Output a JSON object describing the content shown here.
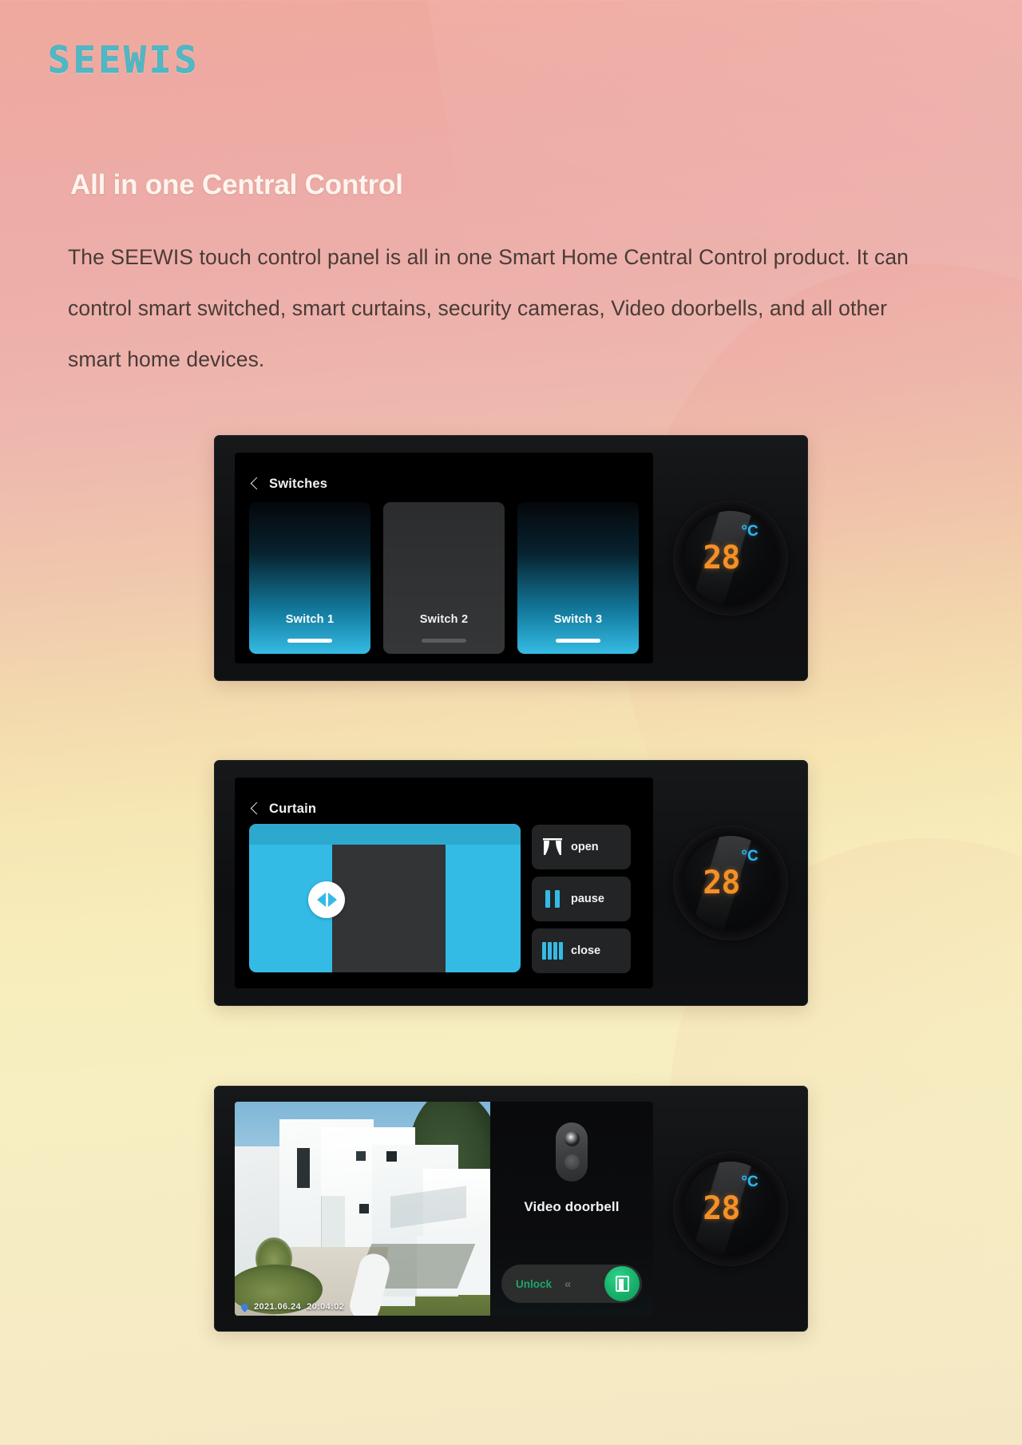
{
  "brand": {
    "logo": "SEEWIS"
  },
  "hero": {
    "headline": "All in one Central Control",
    "paragraph": "The SEEWIS touch control panel is all in one Smart Home Central Control product. It can control smart switched, smart curtains, security cameras, Video doorbells, and all other smart home devices."
  },
  "colors": {
    "accent_cyan": "#33bbe6",
    "brand_teal": "#4fb8c4",
    "temp_orange": "#f59026",
    "unit_cyan": "#33b7ef",
    "unlock_green": "#16b06a",
    "panel_black": "#111214"
  },
  "panels": [
    {
      "id": "switches",
      "title": "Switches",
      "back_icon": "chevron-left-icon",
      "switches": [
        {
          "label": "Switch 1",
          "state": "on"
        },
        {
          "label": "Switch 2",
          "state": "off"
        },
        {
          "label": "Switch 3",
          "state": "on"
        }
      ],
      "dial": {
        "temperature": "28",
        "unit": "°C"
      }
    },
    {
      "id": "curtain",
      "title": "Curtain",
      "back_icon": "chevron-left-icon",
      "handle_icon": "left-right-arrows-icon",
      "buttons": [
        {
          "label": "open",
          "icon": "curtain-open-icon"
        },
        {
          "label": "pause",
          "icon": "pause-icon"
        },
        {
          "label": "close",
          "icon": "curtain-closed-icon"
        }
      ],
      "dial": {
        "temperature": "28",
        "unit": "°C"
      }
    },
    {
      "id": "video-doorbell",
      "title": "Video doorbell",
      "camera": {
        "timestamp_date": "2021.06.24",
        "timestamp_time": "20:04:02",
        "location_icon": "map-pin-icon"
      },
      "device_icon": "doorbell-icon",
      "unlock": {
        "label": "Unlock",
        "chevrons": "«",
        "knob_icon": "open-door-icon"
      },
      "dial": {
        "temperature": "28",
        "unit": "°C"
      }
    }
  ]
}
